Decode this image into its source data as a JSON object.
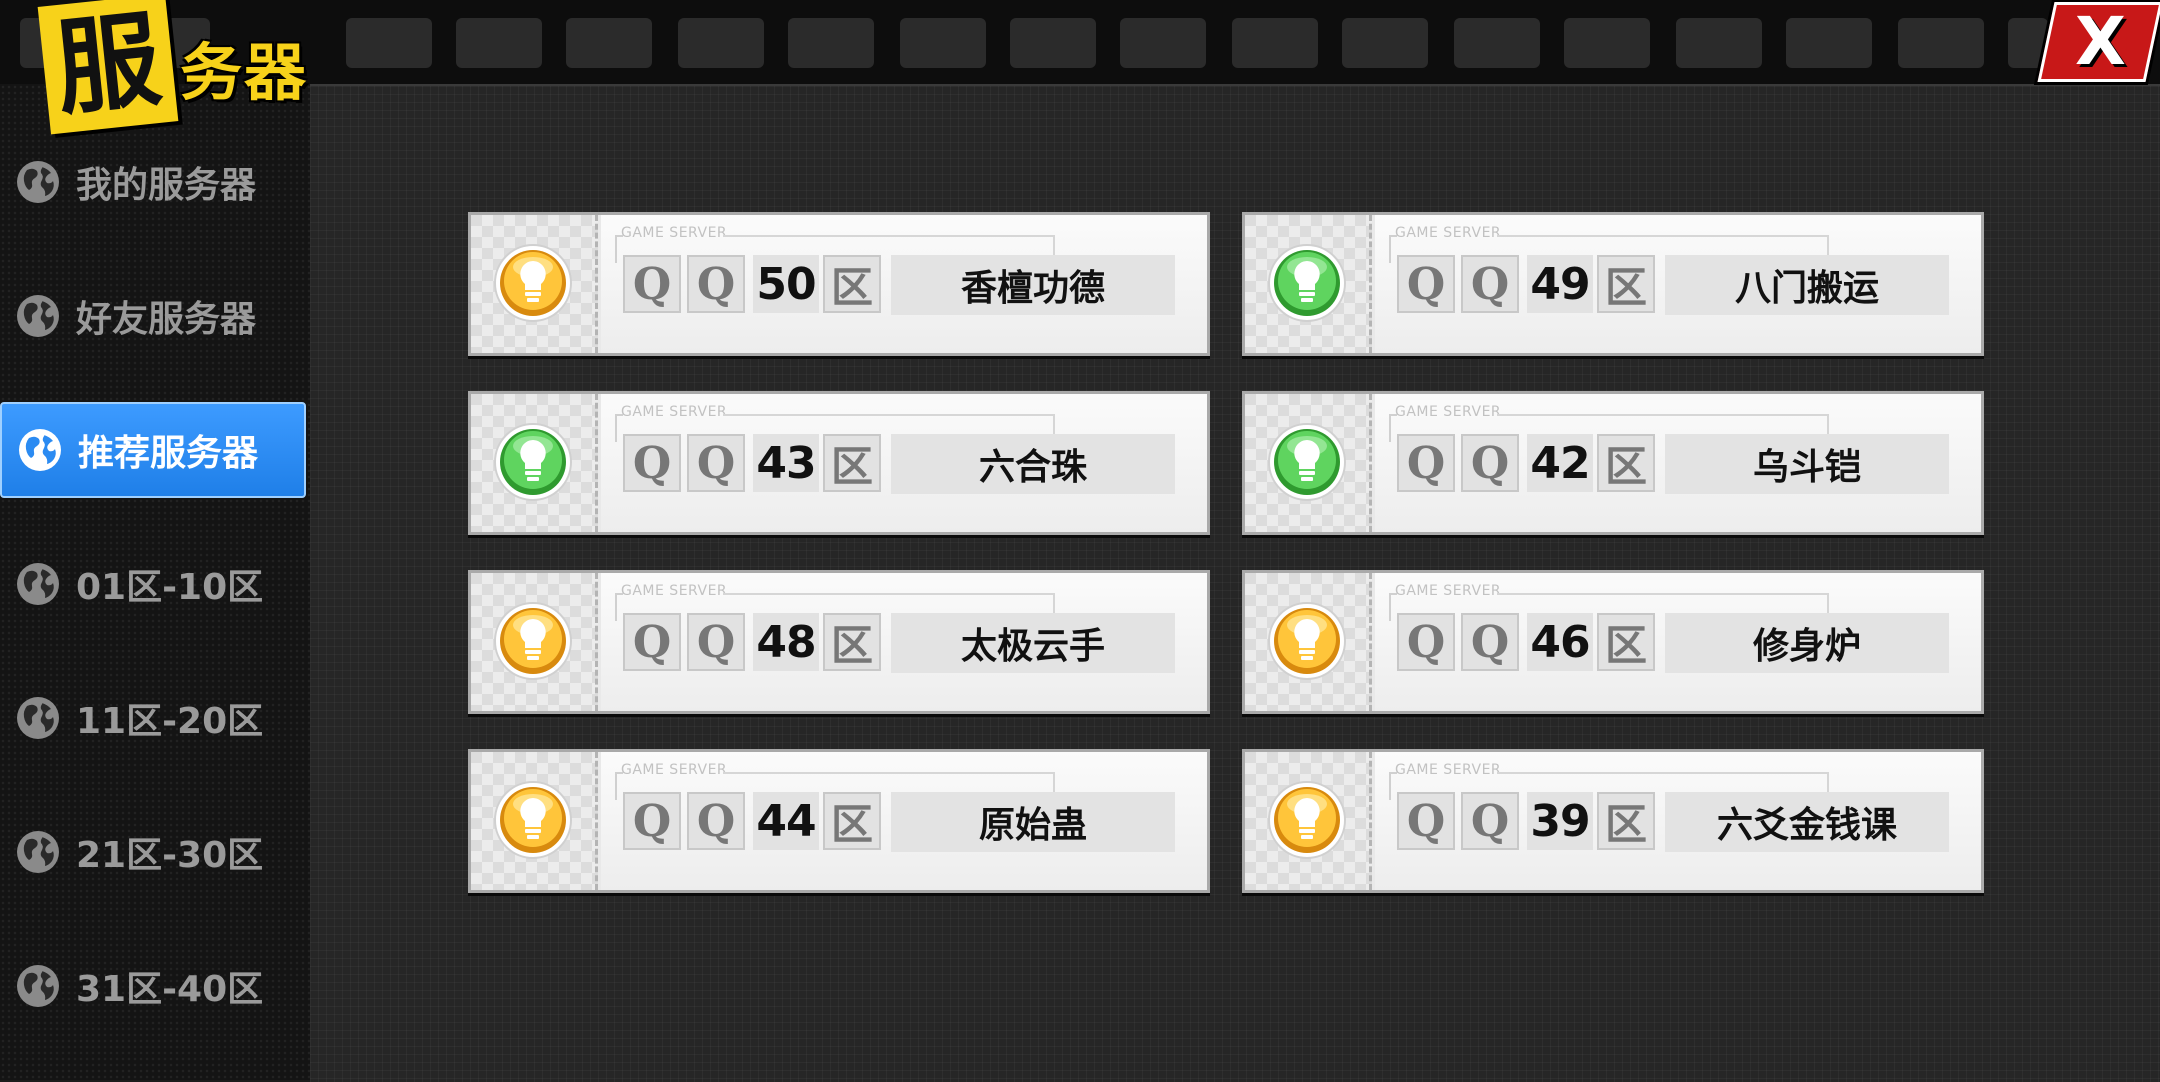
{
  "title": {
    "first_char": "服",
    "rest": "务器"
  },
  "close_label": "X",
  "sidebar": {
    "items": [
      {
        "label": "我的服务器",
        "active": false
      },
      {
        "label": "好友服务器",
        "active": false
      },
      {
        "label": "推荐服务器",
        "active": true
      },
      {
        "label": "01区-10区",
        "active": false
      },
      {
        "label": "11区-20区",
        "active": false
      },
      {
        "label": "21区-30区",
        "active": false
      },
      {
        "label": "31区-40区",
        "active": false
      }
    ]
  },
  "colors": {
    "accent_blue": "#2b8bf2",
    "title_yellow": "#f7d21a",
    "close_red": "#c81818",
    "status_green": "#3cb43c",
    "status_yellow": "#f0a81a"
  },
  "card_labels": {
    "game_server": "GAME SERVER",
    "q": "Q",
    "qu": "区"
  },
  "servers": [
    {
      "num": "50",
      "name": "香檀功德",
      "status": "yellow"
    },
    {
      "num": "49",
      "name": "八门搬运",
      "status": "green"
    },
    {
      "num": "43",
      "name": "六合珠",
      "status": "green"
    },
    {
      "num": "42",
      "name": "乌斗铠",
      "status": "green"
    },
    {
      "num": "48",
      "name": "太极云手",
      "status": "yellow"
    },
    {
      "num": "46",
      "name": "修身炉",
      "status": "yellow"
    },
    {
      "num": "44",
      "name": "原始蛊",
      "status": "yellow"
    },
    {
      "num": "39",
      "name": "六爻金钱课",
      "status": "yellow"
    }
  ]
}
